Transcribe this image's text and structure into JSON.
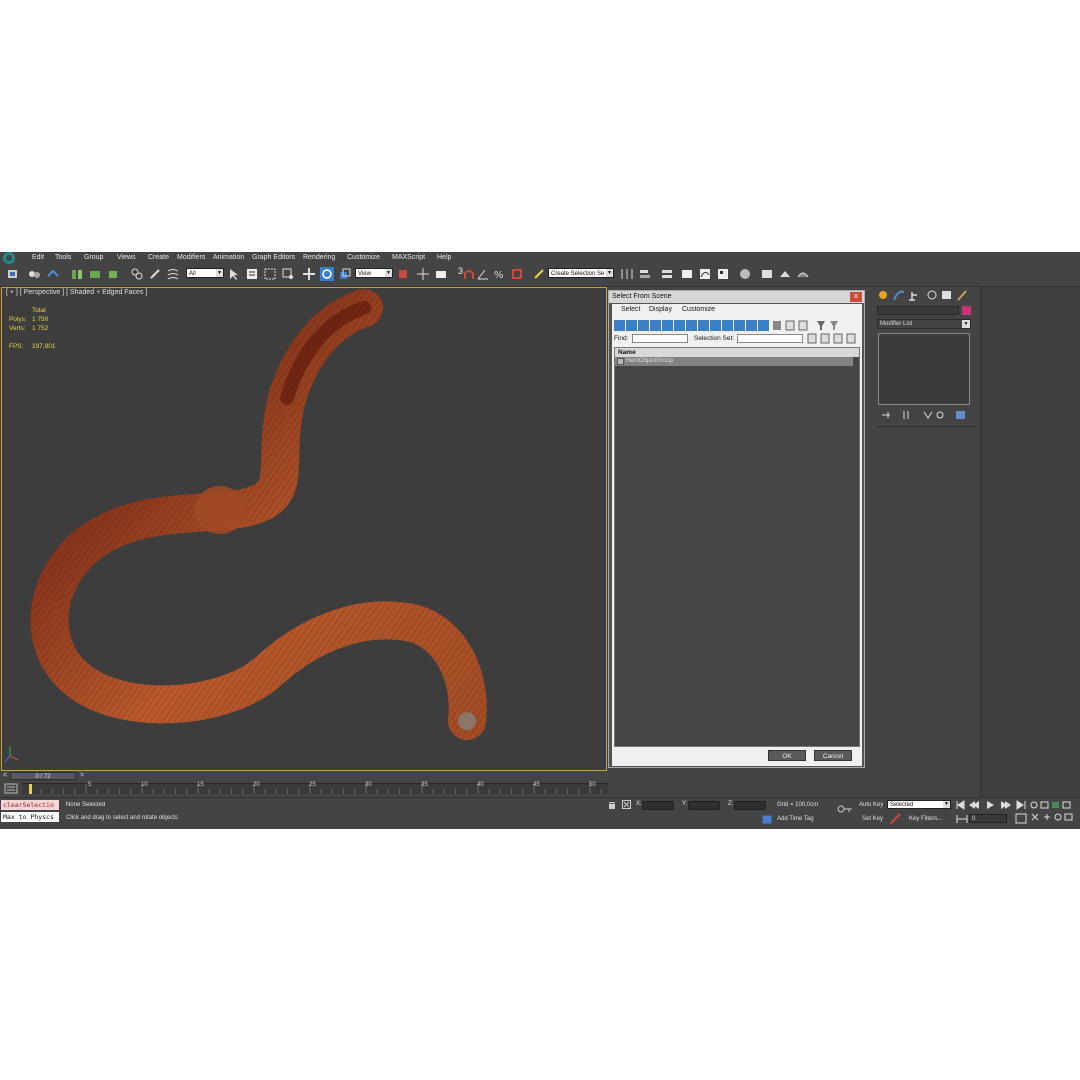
{
  "menu": [
    "Edit",
    "Tools",
    "Group",
    "Views",
    "Create",
    "Modifiers",
    "Animation",
    "Graph Editors",
    "Rendering",
    "Customize",
    "MAXScript",
    "Help"
  ],
  "toolbar": {
    "filter_value": "All",
    "view_value": "View",
    "snap_label": "3",
    "selection_set_value": "Create Selection Se"
  },
  "viewport": {
    "label": "[ + ] [ Perspective ] [ Shaded + Edged Faces ]",
    "stats": {
      "total_label": "Total",
      "polys_label": "Polys:",
      "polys_value": "1 750",
      "verts_label": "Verts:",
      "verts_value": "1 752",
      "fps_label": "FPS:",
      "fps_value": "197,801"
    }
  },
  "dialog": {
    "title": "Select From Scene",
    "close_label": "x",
    "menu": [
      "Select",
      "Display",
      "Customize"
    ],
    "find_label": "Find:",
    "selection_set_label": "Selection Set:",
    "list_header": "Name",
    "rows": [
      "HeroObjectGroup"
    ],
    "ok_label": "OK",
    "cancel_label": "Cancel"
  },
  "command_panel": {
    "modifier_list_label": "Modifier List",
    "accent_color": "#c8327a"
  },
  "timeline": {
    "slider_value": "0 / 72",
    "tick_labels": [
      "5",
      "10",
      "15",
      "20",
      "25",
      "30",
      "35",
      "40",
      "45",
      "50"
    ]
  },
  "status": {
    "maxscript_top": "clearSelectio",
    "maxscript_bottom": "Max to Physcs",
    "selection_text": "None Selected",
    "prompt_text": "Click and drag to select and rotate objects",
    "x_label": "X:",
    "y_label": "Y:",
    "z_label": "Z:",
    "grid_text": "Grid = 100,0cm",
    "add_time_tag": "Add Time Tag",
    "auto_key": "Auto Key",
    "set_key": "Set Key",
    "key_mode_value": "Selected",
    "key_filters": "Key Filters...",
    "frame_value": "0"
  },
  "colors": {
    "worm_main": "#b0542a",
    "worm_head": "#6e1e10",
    "viewport_border": "#c9a23a",
    "stats_text": "#e8d24a"
  }
}
